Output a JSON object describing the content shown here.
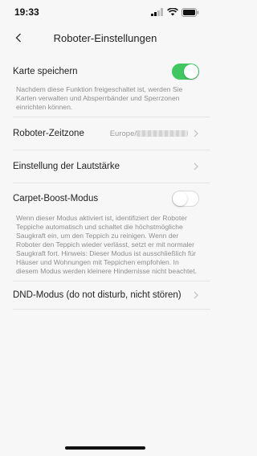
{
  "status": {
    "time": "19:33"
  },
  "nav": {
    "title": "Roboter-Einstellungen",
    "back_icon": "chevron-left-icon"
  },
  "karte": {
    "label": "Karte speichern",
    "toggle_on": true,
    "desc": "Nachdem diese Funktion freigeschaltet ist, werden Sie Karten verwalten und Absperrbänder und Sperrzonen einrichten können."
  },
  "zeitzone": {
    "label": "Roboter-Zeitzone",
    "value": "Europe/"
  },
  "lautstaerke": {
    "label": "Einstellung der Lautstärke"
  },
  "carpet": {
    "label": "Carpet-Boost-Modus",
    "toggle_on": false,
    "desc": "Wenn dieser Modus aktiviert ist, identifiziert der Roboter Teppiche automatisch und schaltet die höchstmögliche Saugkraft ein, um den Teppich zu reinigen. Wenn der Roboter den Teppich wieder verlässt, setzt er mit normaler Saugkraft fort. Hinweis: Dieser Modus ist ausschließlich für Häuser und Wohnungen mit Teppichen empfohlen. In diesem Modus werden kleinere Hindernisse nicht beachtet."
  },
  "dnd": {
    "label": "DND-Modus (do not disturb, nicht stören)"
  },
  "colors": {
    "toggle_on": "#3ec85f",
    "background": "#f7f7f7",
    "secondary_text": "#8e8e8e"
  }
}
